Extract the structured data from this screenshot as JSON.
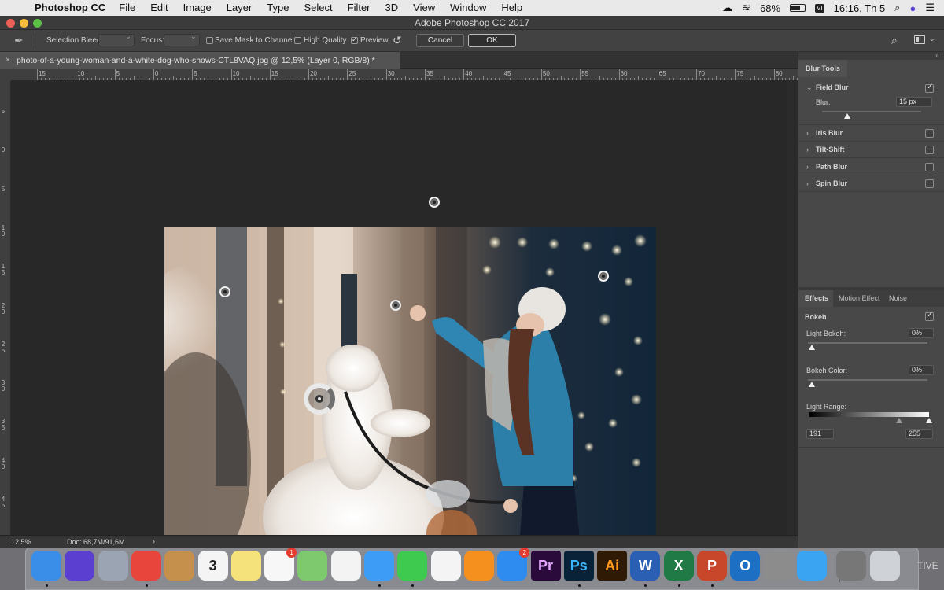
{
  "menubar": {
    "app_name": "Photoshop CC",
    "items": [
      "File",
      "Edit",
      "Image",
      "Layer",
      "Type",
      "Select",
      "Filter",
      "3D",
      "View",
      "Window",
      "Help"
    ],
    "battery": "68%",
    "input_method": "VI",
    "clock": "16:16, Th 5"
  },
  "window": {
    "title": "Adobe Photoshop CC 2017"
  },
  "options": {
    "selection_bleed_label": "Selection Bleed:",
    "focus_label": "Focus:",
    "save_mask_label": "Save Mask to Channels",
    "save_mask_checked": false,
    "high_quality_label": "High Quality",
    "high_quality_checked": false,
    "preview_label": "Preview",
    "preview_checked": true,
    "cancel_label": "Cancel",
    "ok_label": "OK"
  },
  "document": {
    "tab_title": "photo-of-a-young-woman-and-a-white-dog-who-shows-CTL8VAQ.jpg @ 12,5% (Layer 0, RGB/8) *"
  },
  "rulers": {
    "horizontal": [
      "15",
      "10",
      "5",
      "0",
      "5",
      "10",
      "15",
      "20",
      "25",
      "30",
      "35",
      "40",
      "45",
      "50",
      "55",
      "60",
      "65",
      "70",
      "75",
      "80"
    ],
    "vertical": [
      "5",
      "0",
      "5",
      "10",
      "15",
      "20",
      "25",
      "30",
      "35",
      "40",
      "45"
    ]
  },
  "status": {
    "zoom": "12,5%",
    "doc_size": "Doc: 68,7M/91,6M",
    "arrow": "›"
  },
  "blur_tools": {
    "panel_title": "Blur Tools",
    "field_blur": {
      "label": "Field Blur",
      "checked": true,
      "blur_label": "Blur:",
      "blur_value": "15 px",
      "slider_level": 0.25
    },
    "others": [
      {
        "label": "Iris Blur",
        "checked": false
      },
      {
        "label": "Tilt-Shift",
        "checked": false
      },
      {
        "label": "Path Blur",
        "checked": false
      },
      {
        "label": "Spin Blur",
        "checked": false
      }
    ]
  },
  "effects": {
    "tabs": [
      "Effects",
      "Motion Effect",
      "Noise"
    ],
    "active_tab": "Effects",
    "bokeh_label": "Bokeh",
    "bokeh_checked": true,
    "light_bokeh_label": "Light Bokeh:",
    "light_bokeh_value": "0%",
    "bokeh_color_label": "Bokeh Color:",
    "bokeh_color_value": "0%",
    "light_range_label": "Light Range:",
    "light_range_low": "191",
    "light_range_high": "255"
  },
  "dock": {
    "apps": [
      {
        "name": "finder-icon",
        "text": "",
        "color": "#3b8ee8"
      },
      {
        "name": "siri-icon",
        "text": "",
        "color": "#5a3fd1"
      },
      {
        "name": "launchpad-icon",
        "text": "",
        "color": "#9aa4b2"
      },
      {
        "name": "chrome-icon",
        "text": "",
        "color": "#e8453c"
      },
      {
        "name": "contacts-icon",
        "text": "",
        "color": "#c5904b"
      },
      {
        "name": "calendar-icon",
        "text": "3",
        "color": "#f4f4f4"
      },
      {
        "name": "notes-icon",
        "text": "",
        "color": "#f6e27a"
      },
      {
        "name": "reminders-icon",
        "text": "",
        "color": "#f7f7f7",
        "badge": "1"
      },
      {
        "name": "maps-icon",
        "text": "",
        "color": "#7ec86d"
      },
      {
        "name": "photos-icon",
        "text": "",
        "color": "#f3f3f3"
      },
      {
        "name": "messages-icon",
        "text": "",
        "color": "#3d9cf5"
      },
      {
        "name": "facetime-icon",
        "text": "",
        "color": "#3ec94f"
      },
      {
        "name": "itunes-icon",
        "text": "",
        "color": "#f4f4f4"
      },
      {
        "name": "ibooks-icon",
        "text": "",
        "color": "#f58f1e"
      },
      {
        "name": "appstore-icon",
        "text": "",
        "color": "#2e8cf0",
        "badge": "2"
      },
      {
        "name": "premiere-icon",
        "text": "Pr",
        "color": "#2a0a3b"
      },
      {
        "name": "photoshop-icon",
        "text": "Ps",
        "color": "#0a2238"
      },
      {
        "name": "illustrator-icon",
        "text": "Ai",
        "color": "#2e1a05"
      },
      {
        "name": "word-icon",
        "text": "W",
        "color": "#2b5fb3"
      },
      {
        "name": "excel-icon",
        "text": "X",
        "color": "#1f7a45"
      },
      {
        "name": "powerpoint-icon",
        "text": "P",
        "color": "#c8472a"
      },
      {
        "name": "outlook-icon",
        "text": "O",
        "color": "#1d6fc4"
      },
      {
        "name": "system-preferences-icon",
        "text": "",
        "color": "#8c8c8c"
      },
      {
        "name": "safari-icon",
        "text": "",
        "color": "#3aa4f3"
      },
      {
        "name": "downloads-icon",
        "text": "",
        "color": "#777777"
      },
      {
        "name": "trash-icon",
        "text": "",
        "color": "#cfd3d8"
      }
    ],
    "trailing_text": "TIVE"
  }
}
